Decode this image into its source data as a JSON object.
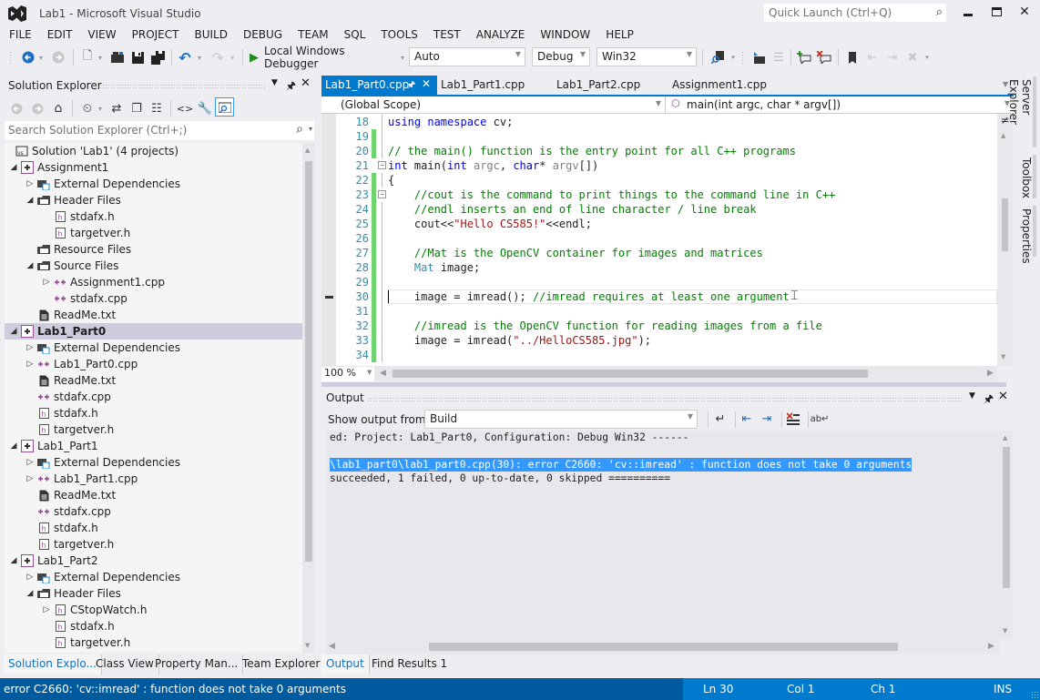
{
  "window": {
    "title": "Lab1 - Microsoft Visual Studio",
    "quick_launch_placeholder": "Quick Launch (Ctrl+Q)"
  },
  "menu": [
    "FILE",
    "EDIT",
    "VIEW",
    "PROJECT",
    "BUILD",
    "DEBUG",
    "TEAM",
    "SQL",
    "TOOLS",
    "TEST",
    "ANALYZE",
    "WINDOW",
    "HELP"
  ],
  "toolbar": {
    "debugger_label": "Local Windows Debugger",
    "solution_config_combo": "Auto",
    "config_combo": "Debug",
    "platform_combo": "Win32"
  },
  "solution_explorer": {
    "title": "Solution Explorer",
    "search_placeholder": "Search Solution Explorer (Ctrl+;)",
    "items": [
      {
        "label": "Solution 'Lab1' (4 projects)",
        "depth": 0,
        "icon": "solution-icon",
        "twisty": "none"
      },
      {
        "label": "Assignment1",
        "depth": 1,
        "icon": "project-icon",
        "twisty": "expanded"
      },
      {
        "label": "External Dependencies",
        "depth": 2,
        "icon": "external-deps-icon",
        "twisty": "collapsed"
      },
      {
        "label": "Header Files",
        "depth": 2,
        "icon": "folder-icon",
        "twisty": "expanded"
      },
      {
        "label": "stdafx.h",
        "depth": 3,
        "icon": "header-file-icon",
        "twisty": "none"
      },
      {
        "label": "targetver.h",
        "depth": 3,
        "icon": "header-file-icon",
        "twisty": "none"
      },
      {
        "label": "Resource Files",
        "depth": 2,
        "icon": "folder-icon",
        "twisty": "none"
      },
      {
        "label": "Source Files",
        "depth": 2,
        "icon": "folder-icon",
        "twisty": "expanded"
      },
      {
        "label": "Assignment1.cpp",
        "depth": 3,
        "icon": "cpp-file-icon",
        "twisty": "collapsed"
      },
      {
        "label": "stdafx.cpp",
        "depth": 3,
        "icon": "cpp-file-icon",
        "twisty": "none"
      },
      {
        "label": "ReadMe.txt",
        "depth": 2,
        "icon": "text-file-icon",
        "twisty": "none"
      },
      {
        "label": "Lab1_Part0",
        "depth": 1,
        "icon": "project-icon",
        "twisty": "expanded",
        "selected": true
      },
      {
        "label": "External Dependencies",
        "depth": 2,
        "icon": "external-deps-icon",
        "twisty": "collapsed"
      },
      {
        "label": "Lab1_Part0.cpp",
        "depth": 2,
        "icon": "cpp-file-icon",
        "twisty": "collapsed"
      },
      {
        "label": "ReadMe.txt",
        "depth": 2,
        "icon": "text-file-icon",
        "twisty": "none"
      },
      {
        "label": "stdafx.cpp",
        "depth": 2,
        "icon": "cpp-file-icon",
        "twisty": "none"
      },
      {
        "label": "stdafx.h",
        "depth": 2,
        "icon": "header-file-icon",
        "twisty": "none"
      },
      {
        "label": "targetver.h",
        "depth": 2,
        "icon": "header-file-icon",
        "twisty": "none"
      },
      {
        "label": "Lab1_Part1",
        "depth": 1,
        "icon": "project-icon",
        "twisty": "expanded"
      },
      {
        "label": "External Dependencies",
        "depth": 2,
        "icon": "external-deps-icon",
        "twisty": "collapsed"
      },
      {
        "label": "Lab1_Part1.cpp",
        "depth": 2,
        "icon": "cpp-file-icon",
        "twisty": "collapsed"
      },
      {
        "label": "ReadMe.txt",
        "depth": 2,
        "icon": "text-file-icon",
        "twisty": "none"
      },
      {
        "label": "stdafx.cpp",
        "depth": 2,
        "icon": "cpp-file-icon",
        "twisty": "none"
      },
      {
        "label": "stdafx.h",
        "depth": 2,
        "icon": "header-file-icon",
        "twisty": "none"
      },
      {
        "label": "targetver.h",
        "depth": 2,
        "icon": "header-file-icon",
        "twisty": "none"
      },
      {
        "label": "Lab1_Part2",
        "depth": 1,
        "icon": "project-icon",
        "twisty": "expanded"
      },
      {
        "label": "External Dependencies",
        "depth": 2,
        "icon": "external-deps-icon",
        "twisty": "collapsed"
      },
      {
        "label": "Header Files",
        "depth": 2,
        "icon": "folder-icon",
        "twisty": "expanded"
      },
      {
        "label": "CStopWatch.h",
        "depth": 3,
        "icon": "header-file-icon",
        "twisty": "collapsed"
      },
      {
        "label": "stdafx.h",
        "depth": 3,
        "icon": "header-file-icon",
        "twisty": "none"
      },
      {
        "label": "targetver.h",
        "depth": 3,
        "icon": "header-file-icon",
        "twisty": "none"
      }
    ],
    "bottom_tabs": [
      "Solution Explo...",
      "Class View",
      "Property Man...",
      "Team Explorer"
    ]
  },
  "editor": {
    "tabs": [
      {
        "label": "Lab1_Part0.cpp",
        "active": true
      },
      {
        "label": "Lab1_Part1.cpp"
      },
      {
        "label": "Lab1_Part2.cpp"
      },
      {
        "label": "Assignment1.cpp"
      }
    ],
    "scope_combo": "(Global Scope)",
    "member_combo": "main(int argc, char * argv[])",
    "zoom": "100 %",
    "current_line": 30,
    "lines": [
      {
        "n": 18,
        "tokens": [
          [
            "kw",
            "using"
          ],
          [
            "",
            " "
          ],
          [
            "kw",
            "namespace"
          ],
          [
            "",
            " cv;"
          ]
        ],
        "changed": false
      },
      {
        "n": 19,
        "tokens": [],
        "changed": true
      },
      {
        "n": 20,
        "tokens": [
          [
            "cm",
            "// the main() function is the entry point for all C++ programs"
          ]
        ],
        "changed": true
      },
      {
        "n": 21,
        "tokens": [
          [
            "kw",
            "int"
          ],
          [
            "",
            " main("
          ],
          [
            "kw",
            "int"
          ],
          [
            "",
            " "
          ],
          [
            "pm",
            "argc"
          ],
          [
            "",
            ", "
          ],
          [
            "kw",
            "char"
          ],
          [
            "",
            "* "
          ],
          [
            "pm",
            "argv"
          ],
          [
            "",
            "[])"
          ]
        ],
        "changed": false,
        "fold": true
      },
      {
        "n": 22,
        "tokens": [
          [
            "",
            "{"
          ]
        ],
        "changed": true
      },
      {
        "n": 23,
        "tokens": [
          [
            "",
            "    "
          ],
          [
            "cm",
            "//cout is the command to print things to the command line in C++"
          ]
        ],
        "changed": true,
        "fold": true
      },
      {
        "n": 24,
        "tokens": [
          [
            "",
            "    "
          ],
          [
            "cm",
            "//endl inserts an end of line character / line break"
          ]
        ],
        "changed": true
      },
      {
        "n": 25,
        "tokens": [
          [
            "",
            "    cout<<"
          ],
          [
            "str",
            "\"Hello CS585!\""
          ],
          [
            "",
            "<<endl;"
          ]
        ],
        "changed": true
      },
      {
        "n": 26,
        "tokens": [],
        "changed": true
      },
      {
        "n": 27,
        "tokens": [
          [
            "",
            "    "
          ],
          [
            "cm",
            "//Mat is the OpenCV container for images and matrices"
          ]
        ],
        "changed": true
      },
      {
        "n": 28,
        "tokens": [
          [
            "",
            "    "
          ],
          [
            "ty",
            "Mat"
          ],
          [
            "",
            " image;"
          ]
        ],
        "changed": true
      },
      {
        "n": 29,
        "tokens": [],
        "changed": true
      },
      {
        "n": 30,
        "tokens": [
          [
            "",
            "    image = imread(); "
          ],
          [
            "cm",
            "//imread requires at least one argument"
          ]
        ],
        "changed": true
      },
      {
        "n": 31,
        "tokens": [],
        "changed": true
      },
      {
        "n": 32,
        "tokens": [
          [
            "",
            "    "
          ],
          [
            "cm",
            "//imread is the OpenCV function for reading images from a file"
          ]
        ],
        "changed": true
      },
      {
        "n": 33,
        "tokens": [
          [
            "",
            "    image = imread("
          ],
          [
            "str",
            "\"../HelloCS585.jpg\""
          ],
          [
            "",
            ");"
          ]
        ],
        "changed": true
      },
      {
        "n": 34,
        "tokens": [],
        "changed": true
      }
    ]
  },
  "output": {
    "title": "Output",
    "show_from_label": "Show output from:",
    "source": "Build",
    "lines": [
      {
        "text": "ed: Project: Lab1_Part0, Configuration: Debug Win32 ------",
        "highlight": false
      },
      {
        "text": "",
        "highlight": false
      },
      {
        "text": "\\lab1_part0\\lab1_part0.cpp(30): error C2660: 'cv::imread' : function does not take 0 arguments",
        "highlight": true
      },
      {
        "text": "succeeded, 1 failed, 0 up-to-date, 0 skipped ==========",
        "highlight": false
      }
    ],
    "bottom_tabs": [
      "Output",
      "Find Results 1"
    ]
  },
  "right_rail": [
    "Server Explorer",
    "Toolbox",
    "Properties"
  ],
  "status": {
    "message": "error C2660: 'cv::imread' : function does not take 0 arguments",
    "line": "Ln 30",
    "col": "Col 1",
    "ch": "Ch 1",
    "mode": "INS"
  },
  "colors": {
    "accent": "#007acc",
    "status_bar": "#005a9e",
    "selection": "#3399ff",
    "change_bar": "#6fd36f"
  }
}
